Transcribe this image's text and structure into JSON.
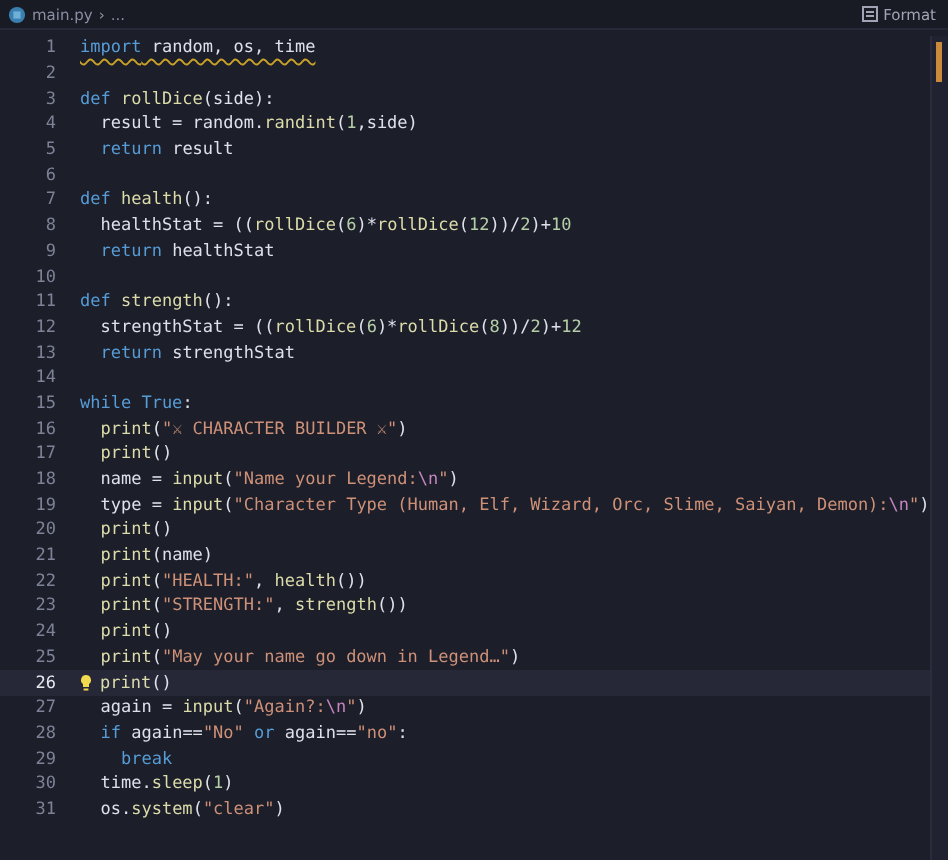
{
  "breadcrumb": {
    "file": "main.py",
    "separator": "›",
    "rest": "..."
  },
  "toolbar": {
    "format": "Format"
  },
  "lines": [
    {
      "n": "1",
      "selected": false,
      "warning": true,
      "t": [
        {
          "kind": "keyword",
          "text": "import"
        },
        {
          "kind": "plain",
          "text": " random, os, time"
        }
      ]
    },
    {
      "n": "2",
      "selected": false
    },
    {
      "n": "3",
      "selected": false,
      "t": [
        {
          "kind": "keyword",
          "text": "def"
        },
        {
          "kind": "function",
          "text": " rollDice"
        },
        {
          "kind": "plain",
          "text": "(side):"
        }
      ]
    },
    {
      "n": "4",
      "selected": false,
      "t": [
        {
          "kind": "plain",
          "text": "  result = random."
        },
        {
          "kind": "function",
          "text": "randint"
        },
        {
          "kind": "plain",
          "text": "("
        },
        {
          "kind": "number",
          "text": "1"
        },
        {
          "kind": "plain",
          "text": ",side)"
        }
      ]
    },
    {
      "n": "5",
      "selected": false,
      "t": [
        {
          "kind": "keyword",
          "text": "  return"
        },
        {
          "kind": "plain",
          "text": " result"
        }
      ]
    },
    {
      "n": "6",
      "selected": false
    },
    {
      "n": "7",
      "selected": false,
      "t": [
        {
          "kind": "keyword",
          "text": "def"
        },
        {
          "kind": "function",
          "text": " health"
        },
        {
          "kind": "plain",
          "text": "():"
        }
      ]
    },
    {
      "n": "8",
      "selected": false,
      "t": [
        {
          "kind": "plain",
          "text": "  healthStat = (("
        },
        {
          "kind": "function",
          "text": "rollDice"
        },
        {
          "kind": "plain",
          "text": "("
        },
        {
          "kind": "number",
          "text": "6"
        },
        {
          "kind": "plain",
          "text": ")*"
        },
        {
          "kind": "function",
          "text": "rollDice"
        },
        {
          "kind": "plain",
          "text": "("
        },
        {
          "kind": "number",
          "text": "12"
        },
        {
          "kind": "plain",
          "text": "))/"
        },
        {
          "kind": "number",
          "text": "2"
        },
        {
          "kind": "plain",
          "text": ")+"
        },
        {
          "kind": "number",
          "text": "10"
        }
      ]
    },
    {
      "n": "9",
      "selected": false,
      "t": [
        {
          "kind": "keyword",
          "text": "  return"
        },
        {
          "kind": "plain",
          "text": " healthStat"
        }
      ]
    },
    {
      "n": "10",
      "selected": false
    },
    {
      "n": "11",
      "selected": false,
      "t": [
        {
          "kind": "keyword",
          "text": "def"
        },
        {
          "kind": "function",
          "text": " strength"
        },
        {
          "kind": "plain",
          "text": "():"
        }
      ]
    },
    {
      "n": "12",
      "selected": false,
      "t": [
        {
          "kind": "plain",
          "text": "  strengthStat = (("
        },
        {
          "kind": "function",
          "text": "rollDice"
        },
        {
          "kind": "plain",
          "text": "("
        },
        {
          "kind": "number",
          "text": "6"
        },
        {
          "kind": "plain",
          "text": ")*"
        },
        {
          "kind": "function",
          "text": "rollDice"
        },
        {
          "kind": "plain",
          "text": "("
        },
        {
          "kind": "number",
          "text": "8"
        },
        {
          "kind": "plain",
          "text": "))/"
        },
        {
          "kind": "number",
          "text": "2"
        },
        {
          "kind": "plain",
          "text": ")+"
        },
        {
          "kind": "number",
          "text": "12"
        }
      ]
    },
    {
      "n": "13",
      "selected": false,
      "t": [
        {
          "kind": "keyword",
          "text": "  return"
        },
        {
          "kind": "plain",
          "text": " strengthStat"
        }
      ]
    },
    {
      "n": "14",
      "selected": false
    },
    {
      "n": "15",
      "selected": false,
      "t": [
        {
          "kind": "keyword",
          "text": "while True"
        },
        {
          "kind": "plain",
          "text": ":"
        }
      ]
    },
    {
      "n": "16",
      "selected": false,
      "t": [
        {
          "kind": "function",
          "text": "  print"
        },
        {
          "kind": "plain",
          "text": "("
        },
        {
          "kind": "string",
          "text": "\"⚔ CHARACTER BUILDER ⚔\""
        },
        {
          "kind": "plain",
          "text": ")"
        }
      ]
    },
    {
      "n": "17",
      "selected": false,
      "t": [
        {
          "kind": "function",
          "text": "  print"
        },
        {
          "kind": "plain",
          "text": "()"
        }
      ]
    },
    {
      "n": "18",
      "selected": false,
      "t": [
        {
          "kind": "plain",
          "text": "  name = "
        },
        {
          "kind": "function",
          "text": "input"
        },
        {
          "kind": "plain",
          "text": "("
        },
        {
          "kind": "string",
          "text": "\"Name your Legend:"
        },
        {
          "kind": "escape",
          "text": "\\n"
        },
        {
          "kind": "string",
          "text": "\""
        },
        {
          "kind": "plain",
          "text": ")"
        }
      ]
    },
    {
      "n": "19",
      "selected": false,
      "t": [
        {
          "kind": "plain",
          "text": "  type = "
        },
        {
          "kind": "function",
          "text": "input"
        },
        {
          "kind": "plain",
          "text": "("
        },
        {
          "kind": "string",
          "text": "\"Character Type (Human, Elf, Wizard, Orc, Slime, Saiyan, Demon):"
        },
        {
          "kind": "escape",
          "text": "\\n"
        },
        {
          "kind": "string",
          "text": "\""
        },
        {
          "kind": "plain",
          "text": ")"
        }
      ]
    },
    {
      "n": "20",
      "selected": false,
      "t": [
        {
          "kind": "function",
          "text": "  print"
        },
        {
          "kind": "plain",
          "text": "()"
        }
      ]
    },
    {
      "n": "21",
      "selected": false,
      "t": [
        {
          "kind": "function",
          "text": "  print"
        },
        {
          "kind": "plain",
          "text": "(name)"
        }
      ]
    },
    {
      "n": "22",
      "selected": false,
      "t": [
        {
          "kind": "function",
          "text": "  print"
        },
        {
          "kind": "plain",
          "text": "("
        },
        {
          "kind": "string",
          "text": "\"HEALTH:\""
        },
        {
          "kind": "plain",
          "text": ", "
        },
        {
          "kind": "function",
          "text": "health"
        },
        {
          "kind": "plain",
          "text": "())"
        }
      ]
    },
    {
      "n": "23",
      "selected": false,
      "t": [
        {
          "kind": "function",
          "text": "  print"
        },
        {
          "kind": "plain",
          "text": "("
        },
        {
          "kind": "string",
          "text": "\"STRENGTH:\""
        },
        {
          "kind": "plain",
          "text": ", "
        },
        {
          "kind": "function",
          "text": "strength"
        },
        {
          "kind": "plain",
          "text": "())"
        }
      ]
    },
    {
      "n": "24",
      "selected": false,
      "t": [
        {
          "kind": "function",
          "text": "  print"
        },
        {
          "kind": "plain",
          "text": "()"
        }
      ]
    },
    {
      "n": "25",
      "selected": false,
      "t": [
        {
          "kind": "function",
          "text": "  print"
        },
        {
          "kind": "plain",
          "text": "("
        },
        {
          "kind": "string",
          "text": "\"May your name go down in Legend…\""
        },
        {
          "kind": "plain",
          "text": ")"
        }
      ]
    },
    {
      "n": "26",
      "selected": true,
      "hint": true,
      "t": [
        {
          "kind": "function",
          "text": "print"
        },
        {
          "kind": "plain",
          "text": "()"
        }
      ]
    },
    {
      "n": "27",
      "selected": false,
      "t": [
        {
          "kind": "plain",
          "text": "  again = "
        },
        {
          "kind": "function",
          "text": "input"
        },
        {
          "kind": "plain",
          "text": "("
        },
        {
          "kind": "string",
          "text": "\"Again?:"
        },
        {
          "kind": "escape",
          "text": "\\n"
        },
        {
          "kind": "string",
          "text": "\""
        },
        {
          "kind": "plain",
          "text": ")"
        }
      ]
    },
    {
      "n": "28",
      "selected": false,
      "t": [
        {
          "kind": "keyword",
          "text": "  if"
        },
        {
          "kind": "plain",
          "text": " again=="
        },
        {
          "kind": "string",
          "text": "\"No\""
        },
        {
          "kind": "keyword",
          "text": " or"
        },
        {
          "kind": "plain",
          "text": " again=="
        },
        {
          "kind": "string",
          "text": "\"no\""
        },
        {
          "kind": "plain",
          "text": ":"
        }
      ]
    },
    {
      "n": "29",
      "selected": false,
      "t": [
        {
          "kind": "keyword",
          "text": "    break"
        }
      ]
    },
    {
      "n": "30",
      "selected": false,
      "t": [
        {
          "kind": "plain",
          "text": "  time."
        },
        {
          "kind": "function",
          "text": "sleep"
        },
        {
          "kind": "plain",
          "text": "("
        },
        {
          "kind": "number",
          "text": "1"
        },
        {
          "kind": "plain",
          "text": ")"
        }
      ]
    },
    {
      "n": "31",
      "selected": false,
      "t": [
        {
          "kind": "plain",
          "text": "  os."
        },
        {
          "kind": "function",
          "text": "system"
        },
        {
          "kind": "plain",
          "text": "("
        },
        {
          "kind": "string",
          "text": "\"clear\""
        },
        {
          "kind": "plain",
          "text": ")"
        }
      ]
    }
  ]
}
